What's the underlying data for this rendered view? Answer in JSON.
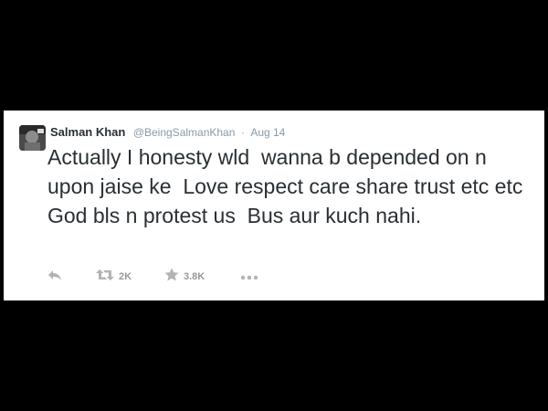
{
  "tweet": {
    "author": {
      "display_name": "Salman Khan",
      "handle": "@BeingSalmanKhan"
    },
    "separator": "·",
    "timestamp": "Aug 14",
    "text": "Actually I honesty wld  wanna b depended on n upon jaise ke  Love respect care share trust etc etc God bls n protest us  Bus aur kuch nahi.",
    "actions": {
      "reply": {
        "icon": "reply-icon"
      },
      "retweet": {
        "icon": "retweet-icon",
        "count": "2K"
      },
      "favorite": {
        "icon": "star-icon",
        "count": "3.8K"
      },
      "more": {
        "icon": "more-icon"
      }
    }
  },
  "colors": {
    "background": "#000000",
    "card": "#ffffff",
    "text": "#292f33",
    "muted": "#8899a6",
    "icon": "#b3b3b3"
  }
}
